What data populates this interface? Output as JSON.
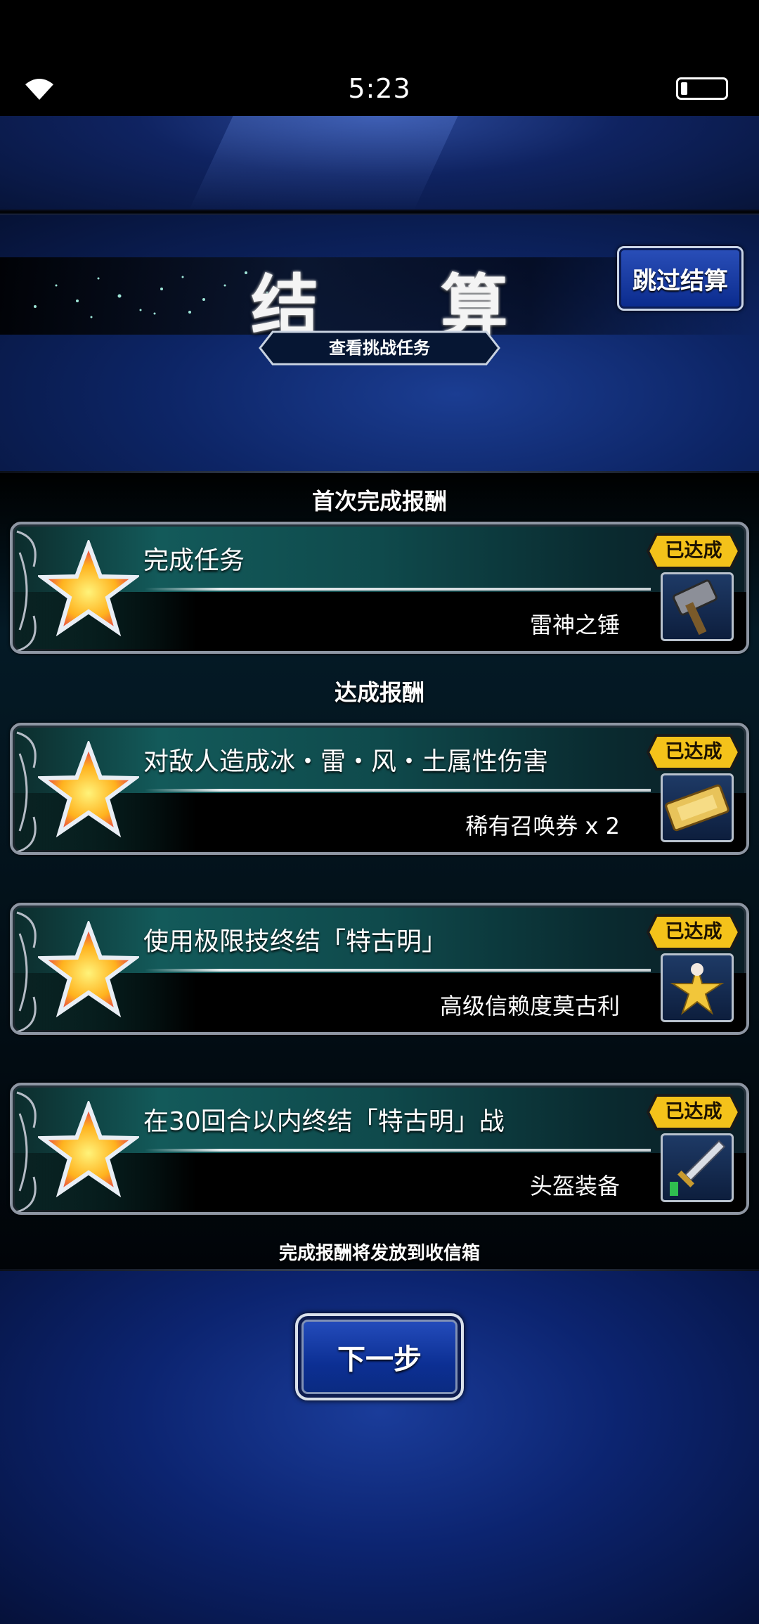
{
  "status_bar": {
    "time": "5:23",
    "wifi_icon": "wifi-icon",
    "battery_icon": "battery-icon"
  },
  "header": {
    "title": "结 算",
    "skip_button": "跳过结算",
    "view_challenges": "查看挑战任务"
  },
  "sections": {
    "first_clear": "首次完成报酬",
    "achievements": "达成报酬",
    "footer_note": "完成报酬将发放到收信箱"
  },
  "missions": [
    {
      "title": "完成任务",
      "reward": "雷神之锤",
      "status": "已达成",
      "icon": "hammer-icon"
    },
    {
      "title": "对敌人造成冰・雷・风・土属性伤害",
      "reward": "稀有召唤券 x 2",
      "status": "已达成",
      "icon": "ticket-icon"
    },
    {
      "title": "使用极限技终结「特古明」",
      "reward": "高级信赖度莫古利",
      "status": "已达成",
      "icon": "moogle-icon"
    },
    {
      "title": "在30回合以内终结「特古明」战",
      "reward": "头盔装备",
      "status": "已达成",
      "icon": "sword-icon"
    }
  ],
  "next_button": "下一步",
  "colors": {
    "badge": "#f4c21a",
    "accent_blue": "#0c2f93",
    "panel_teal": "#135a5a"
  }
}
